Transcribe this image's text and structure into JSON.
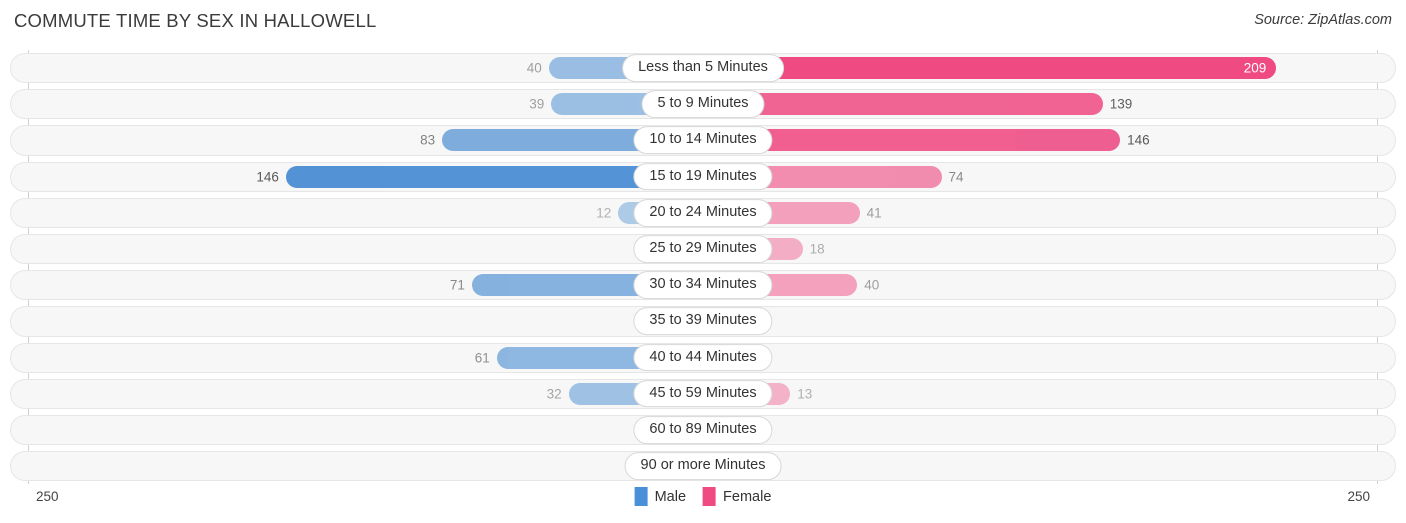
{
  "header": {
    "title": "COMMUTE TIME BY SEX IN HALLOWELL",
    "source": "Source: ZipAtlas.com"
  },
  "axis": {
    "left_tick": "250",
    "right_tick": "250",
    "max": 250
  },
  "legend": {
    "items": [
      {
        "label": "Male",
        "color": "#4a90d9"
      },
      {
        "label": "Female",
        "color": "#ef4a82"
      }
    ]
  },
  "colors": {
    "male": "#3d85d0",
    "female": "#ef4a82",
    "track_bg": "#f7f7f7",
    "track_border": "#e6e6e6",
    "axis_line": "#d0d0d0",
    "text": "#333333"
  },
  "chart_data": {
    "type": "bar",
    "title": "COMMUTE TIME BY SEX IN HALLOWELL",
    "subtitle": "Source: ZipAtlas.com",
    "orientation": "horizontal-diverging",
    "xlabel": "",
    "ylabel": "",
    "xlim": [
      250,
      250
    ],
    "grid": false,
    "legend_position": "bottom-center",
    "categories": [
      "Less than 5 Minutes",
      "5 to 9 Minutes",
      "10 to 14 Minutes",
      "15 to 19 Minutes",
      "20 to 24 Minutes",
      "25 to 29 Minutes",
      "30 to 34 Minutes",
      "35 to 39 Minutes",
      "40 to 44 Minutes",
      "45 to 59 Minutes",
      "60 to 89 Minutes",
      "90 or more Minutes"
    ],
    "series": [
      {
        "name": "Male",
        "color": "#3d85d0",
        "values": [
          40,
          39,
          83,
          146,
          12,
          0,
          71,
          0,
          61,
          32,
          0,
          0
        ]
      },
      {
        "name": "Female",
        "color": "#ef4a82",
        "values": [
          209,
          139,
          146,
          74,
          41,
          18,
          40,
          0,
          0,
          13,
          0,
          0
        ]
      }
    ]
  },
  "rows": [
    {
      "label": "Less than 5 Minutes",
      "male": "40",
      "female": "209",
      "male_value": 40,
      "female_value": 209
    },
    {
      "label": "5 to 9 Minutes",
      "male": "39",
      "female": "139",
      "male_value": 39,
      "female_value": 139
    },
    {
      "label": "10 to 14 Minutes",
      "male": "83",
      "female": "146",
      "male_value": 83,
      "female_value": 146
    },
    {
      "label": "15 to 19 Minutes",
      "male": "146",
      "female": "74",
      "male_value": 146,
      "female_value": 74
    },
    {
      "label": "20 to 24 Minutes",
      "male": "12",
      "female": "41",
      "male_value": 12,
      "female_value": 41
    },
    {
      "label": "25 to 29 Minutes",
      "male": "0",
      "female": "18",
      "male_value": 0,
      "female_value": 18
    },
    {
      "label": "30 to 34 Minutes",
      "male": "71",
      "female": "40",
      "male_value": 71,
      "female_value": 40
    },
    {
      "label": "35 to 39 Minutes",
      "male": "0",
      "female": "0",
      "male_value": 0,
      "female_value": 0
    },
    {
      "label": "40 to 44 Minutes",
      "male": "61",
      "female": "0",
      "male_value": 61,
      "female_value": 0
    },
    {
      "label": "45 to 59 Minutes",
      "male": "32",
      "female": "13",
      "male_value": 32,
      "female_value": 13
    },
    {
      "label": "60 to 89 Minutes",
      "male": "0",
      "female": "0",
      "male_value": 0,
      "female_value": 0
    },
    {
      "label": "90 or more Minutes",
      "male": "0",
      "female": "0",
      "male_value": 0,
      "female_value": 0
    }
  ]
}
